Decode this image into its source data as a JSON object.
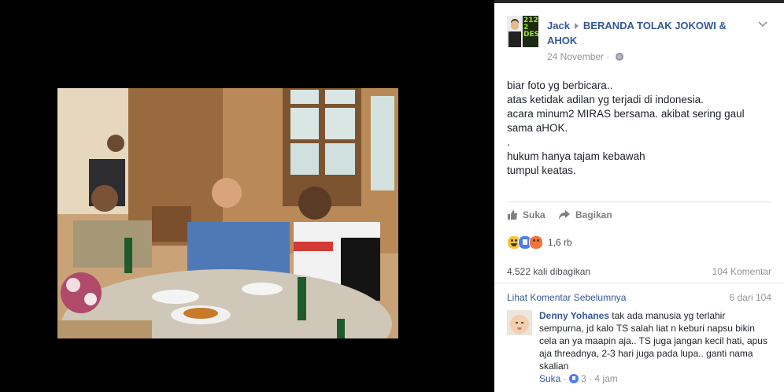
{
  "post": {
    "author": "Jack",
    "target_page": "BERANDA TOLAK JOKOWI & AHOK",
    "date": "24 November",
    "avatar_text": "212 2 DES",
    "text_lines": [
      "biar foto yg berbicara..",
      "atas ketidak adilan yg terjadi di indonesia.",
      "acara minum2 MIRAS bersama. akibat sering gaul",
      "sama aHOK.",
      ".",
      "hukum hanya tajam kebawah",
      "tumpul keatas."
    ]
  },
  "actions": {
    "like": "Suka",
    "share": "Bagikan"
  },
  "reactions": {
    "count": "1,6 rb",
    "types": [
      "haha-icon",
      "like-icon",
      "angry-icon"
    ]
  },
  "stats": {
    "shares": "4.522 kali dibagikan",
    "comments": "104 Komentar"
  },
  "comments_header": {
    "prev_label": "Lihat Komentar Sebelumnya",
    "page_info": "6 dari 104"
  },
  "comment": {
    "author": "Denny Yohanes",
    "text": "tak ada manusia yg terlahir sempurna, jd kalo TS salah liat n keburi napsu bikin cela an ya maapin aja.. TS juga jangan kecil hati, apus aja threadnya, 2-3 hari juga pada lupa.. ganti nama skalian",
    "like_label": "Suka",
    "separator": "·",
    "reaction_count": "3",
    "time": "4 jam"
  },
  "colors": {
    "link": "#365899",
    "muted": "#90949c",
    "text": "#1d2129",
    "viewer_bg": "#000000"
  }
}
